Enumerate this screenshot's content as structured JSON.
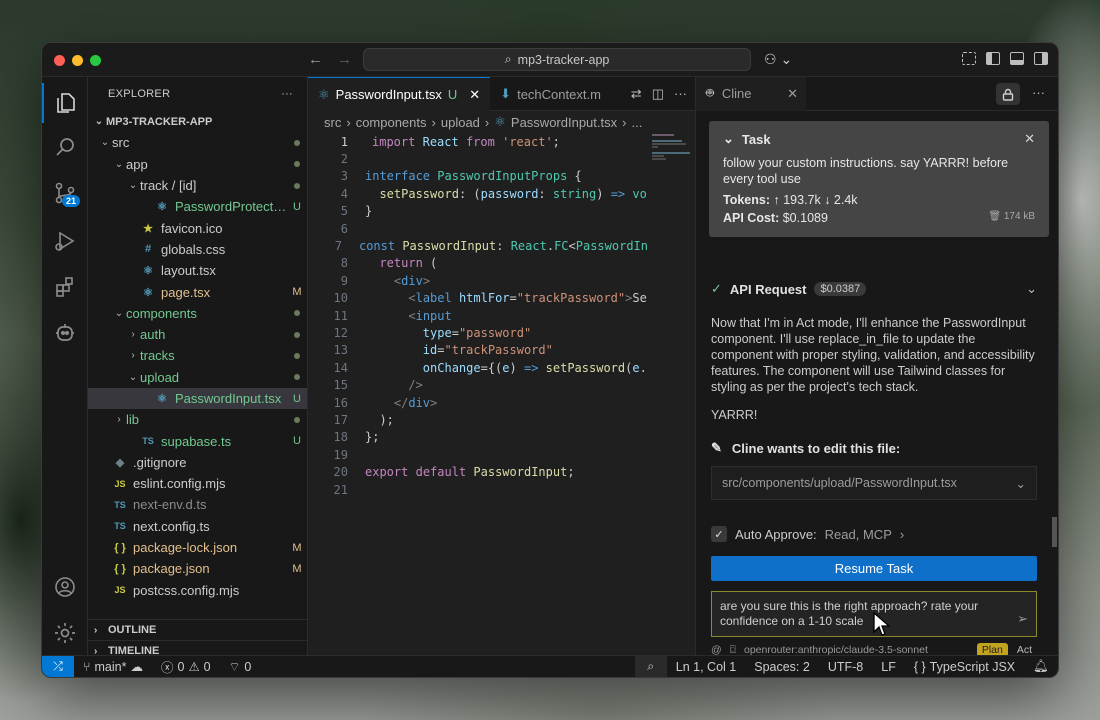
{
  "titlebar": {
    "search_text": "mp3-tracker-app"
  },
  "activity": {
    "source_control_badge": "21"
  },
  "explorer": {
    "title": "EXPLORER",
    "project": "MP3-TRACKER-APP",
    "items": [
      {
        "indent": 0,
        "chev": "⌄",
        "icon": "",
        "name": "src",
        "status": "dot",
        "color": "#cccccc"
      },
      {
        "indent": 1,
        "chev": "⌄",
        "icon": "",
        "name": "app",
        "status": "dot",
        "color": "#cccccc"
      },
      {
        "indent": 2,
        "chev": "⌄",
        "icon": "",
        "name": "track / [id]",
        "status": "dot",
        "color": "#cccccc"
      },
      {
        "indent": 3,
        "chev": "",
        "icon": "⚛",
        "name": "PasswordProtection....",
        "status": "U",
        "color": "#73c991"
      },
      {
        "indent": 2,
        "chev": "",
        "icon": "★",
        "name": "favicon.ico",
        "status": "",
        "color": "#cccccc"
      },
      {
        "indent": 2,
        "chev": "",
        "icon": "#",
        "name": "globals.css",
        "status": "",
        "color": "#cccccc"
      },
      {
        "indent": 2,
        "chev": "",
        "icon": "⚛",
        "name": "layout.tsx",
        "status": "",
        "color": "#cccccc"
      },
      {
        "indent": 2,
        "chev": "",
        "icon": "⚛",
        "name": "page.tsx",
        "status": "M",
        "color": "#e2c08d"
      },
      {
        "indent": 1,
        "chev": "⌄",
        "icon": "",
        "name": "components",
        "status": "dot",
        "color": "#73c991"
      },
      {
        "indent": 2,
        "chev": "›",
        "icon": "",
        "name": "auth",
        "status": "dot",
        "color": "#73c991"
      },
      {
        "indent": 2,
        "chev": "›",
        "icon": "",
        "name": "tracks",
        "status": "dot",
        "color": "#73c991"
      },
      {
        "indent": 2,
        "chev": "⌄",
        "icon": "",
        "name": "upload",
        "status": "dot",
        "color": "#73c991"
      },
      {
        "indent": 3,
        "chev": "",
        "icon": "⚛",
        "name": "PasswordInput.tsx",
        "status": "U",
        "color": "#73c991",
        "selected": true
      },
      {
        "indent": 1,
        "chev": "›",
        "icon": "",
        "name": "lib",
        "status": "dot",
        "color": "#73c991"
      },
      {
        "indent": 2,
        "chev": "",
        "icon": "TS",
        "name": "supabase.ts",
        "status": "U",
        "color": "#73c991"
      },
      {
        "indent": 0,
        "chev": "",
        "icon": "◆",
        "name": ".gitignore",
        "status": "",
        "color": "#cccccc"
      },
      {
        "indent": 0,
        "chev": "",
        "icon": "JS",
        "name": "eslint.config.mjs",
        "status": "",
        "color": "#cccccc"
      },
      {
        "indent": 0,
        "chev": "",
        "icon": "TS",
        "name": "next-env.d.ts",
        "status": "",
        "color": "#8b8b8b"
      },
      {
        "indent": 0,
        "chev": "",
        "icon": "TS",
        "name": "next.config.ts",
        "status": "",
        "color": "#cccccc"
      },
      {
        "indent": 0,
        "chev": "",
        "icon": "{ }",
        "name": "package-lock.json",
        "status": "M",
        "color": "#e2c08d"
      },
      {
        "indent": 0,
        "chev": "",
        "icon": "{ }",
        "name": "package.json",
        "status": "M",
        "color": "#e2c08d"
      },
      {
        "indent": 0,
        "chev": "",
        "icon": "JS",
        "name": "postcss.config.mjs",
        "status": "",
        "color": "#cccccc"
      }
    ],
    "outline": "OUTLINE",
    "timeline": "TIMELINE"
  },
  "editor": {
    "tabs": [
      {
        "label": "PasswordInput.tsx",
        "badge": "U",
        "active": true
      },
      {
        "label": "techContext.m",
        "badge": "",
        "active": false
      }
    ],
    "breadcrumb": [
      "src",
      "components",
      "upload",
      "PasswordInput.tsx",
      "..."
    ],
    "lines": [
      "1",
      "2",
      "3",
      "4",
      "5",
      "6",
      "7",
      "8",
      "9",
      "10",
      "11",
      "12",
      "13",
      "14",
      "15",
      "16",
      "17",
      "18",
      "19",
      "20",
      "21"
    ]
  },
  "cline": {
    "tab_label": "Cline",
    "task_title": "Task",
    "task_text": "follow your custom instructions. say YARRR! before every tool use",
    "tokens_label": "Tokens:",
    "tokens_value": "↑ 193.7k ↓ 2.4k",
    "cost_label": "API Cost:",
    "cost_value": "$0.1089",
    "size": "174 kB",
    "api_request": "API Request",
    "api_price": "$0.0387",
    "message": "Now that I'm in Act mode, I'll enhance the PasswordInput component. I'll use replace_in_file to update the component with proper styling, validation, and accessibility features. The component will use Tailwind classes for styling as per the project's tech stack.",
    "yarrr": "YARRR!",
    "edit_label": "Cline wants to edit this file:",
    "edit_file": "src/components/upload/PasswordInput.tsx",
    "auto_approve_label": "Auto Approve:",
    "auto_approve_value": "Read, MCP",
    "resume": "Resume Task",
    "chat_text": "are you sure this is the right approach? rate your confidence on a 1-10 scale",
    "model": "openrouter:anthropic/claude-3.5-sonnet",
    "mode_plan": "Plan",
    "mode_act": "Act"
  },
  "status": {
    "branch": "main*",
    "errors": "0",
    "warnings": "0",
    "ports": "0",
    "position": "Ln 1, Col 1",
    "spaces": "Spaces: 2",
    "encoding": "UTF-8",
    "eol": "LF",
    "language": "TypeScript JSX"
  }
}
